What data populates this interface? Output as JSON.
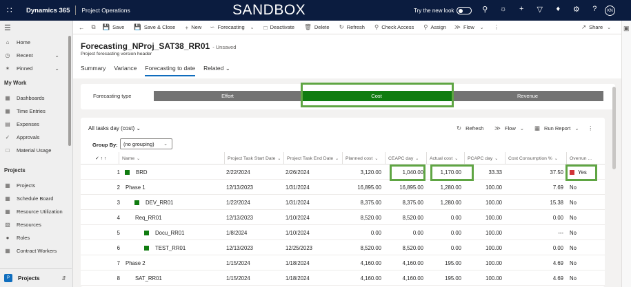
{
  "topbar": {
    "app_name": "Dynamics 365",
    "module_name": "Project Operations",
    "environment_label": "SANDBOX",
    "try_new_look": "Try the new look",
    "avatar_initials": "KN"
  },
  "sidebar": {
    "items": [
      {
        "label": "Home",
        "icon": "home-icon"
      },
      {
        "label": "Recent",
        "icon": "clock-icon"
      },
      {
        "label": "Pinned",
        "icon": "pin-icon"
      }
    ],
    "my_work_heading": "My Work",
    "my_work_items": [
      {
        "label": "Dashboards"
      },
      {
        "label": "Time Entries"
      },
      {
        "label": "Expenses"
      },
      {
        "label": "Approvals"
      },
      {
        "label": "Material Usage"
      }
    ],
    "projects_heading": "Projects",
    "project_items": [
      {
        "label": "Projects"
      },
      {
        "label": "Schedule Board"
      },
      {
        "label": "Resource Utilization"
      },
      {
        "label": "Resources"
      },
      {
        "label": "Roles"
      },
      {
        "label": "Contract Workers"
      }
    ],
    "area": {
      "badge": "P",
      "label": "Projects"
    }
  },
  "commandbar": {
    "save": "Save",
    "save_close": "Save & Close",
    "new": "New",
    "forecasting": "Forecasting",
    "deactivate": "Deactivate",
    "delete": "Delete",
    "refresh": "Refresh",
    "check_access": "Check Access",
    "assign": "Assign",
    "flow": "Flow",
    "share": "Share"
  },
  "record": {
    "title": "Forecasting_NProj_SAT38_RR01",
    "status": "- Unsaved",
    "subtitle": "Project forecasting version header",
    "tabs": [
      "Summary",
      "Variance",
      "Forecasting to date",
      "Related"
    ]
  },
  "forecast_type": {
    "label": "Forecasting type",
    "options": [
      "Effort",
      "Cost",
      "Revenue"
    ],
    "selected": "Cost"
  },
  "grid": {
    "view_name": "All tasks day (cost)",
    "refresh": "Refresh",
    "flow": "Flow",
    "run_report": "Run Report",
    "group_by_label": "Group By:",
    "group_by_value": "(no grouping)",
    "columns": [
      "Name",
      "Project Task Start Date",
      "Project Task End Date",
      "Planned cost",
      "CEAPC day",
      "Actual cost",
      "PCAPC day",
      "Cost Consumption %",
      "Overrun ..."
    ],
    "sort_label": "↑",
    "rows": [
      {
        "num": "1",
        "name": "BRD",
        "start": "2/22/2024",
        "end": "2/26/2024",
        "planned": "3,120.00",
        "ceapc": "1,040.00",
        "actual": "1,170.00",
        "pcapc": "33.33",
        "consumption": "37.50",
        "overrun": "Yes",
        "flag": true,
        "indent": 0,
        "overrun_flag": true
      },
      {
        "num": "2",
        "name": "Phase 1",
        "start": "12/13/2023",
        "end": "1/31/2024",
        "planned": "16,895.00",
        "ceapc": "16,895.00",
        "actual": "1,280.00",
        "pcapc": "100.00",
        "consumption": "7.69",
        "overrun": "No",
        "flag": false,
        "indent": 0,
        "overrun_flag": false
      },
      {
        "num": "3",
        "name": "DEV_RR01",
        "start": "1/22/2024",
        "end": "1/31/2024",
        "planned": "8,375.00",
        "ceapc": "8,375.00",
        "actual": "1,280.00",
        "pcapc": "100.00",
        "consumption": "15.38",
        "overrun": "No",
        "flag": true,
        "indent": 1,
        "overrun_flag": false
      },
      {
        "num": "4",
        "name": "Req_RR01",
        "start": "12/13/2023",
        "end": "1/10/2024",
        "planned": "8,520.00",
        "ceapc": "8,520.00",
        "actual": "0.00",
        "pcapc": "100.00",
        "consumption": "0.00",
        "overrun": "No",
        "flag": false,
        "indent": 1,
        "overrun_flag": false
      },
      {
        "num": "5",
        "name": "Docu_RR01",
        "start": "1/8/2024",
        "end": "1/10/2024",
        "planned": "0.00",
        "ceapc": "0.00",
        "actual": "0.00",
        "pcapc": "100.00",
        "consumption": "---",
        "overrun": "No",
        "flag": true,
        "indent": 2,
        "overrun_flag": false
      },
      {
        "num": "6",
        "name": "TEST_RR01",
        "start": "12/13/2023",
        "end": "12/25/2023",
        "planned": "8,520.00",
        "ceapc": "8,520.00",
        "actual": "0.00",
        "pcapc": "100.00",
        "consumption": "0.00",
        "overrun": "No",
        "flag": true,
        "indent": 2,
        "overrun_flag": false
      },
      {
        "num": "7",
        "name": "Phase 2",
        "start": "1/15/2024",
        "end": "1/18/2024",
        "planned": "4,160.00",
        "ceapc": "4,160.00",
        "actual": "195.00",
        "pcapc": "100.00",
        "consumption": "4.69",
        "overrun": "No",
        "flag": false,
        "indent": 0,
        "overrun_flag": false
      },
      {
        "num": "8",
        "name": "SAT_RR01",
        "start": "1/15/2024",
        "end": "1/18/2024",
        "planned": "4,160.00",
        "ceapc": "4,160.00",
        "actual": "195.00",
        "pcapc": "100.00",
        "consumption": "4.69",
        "overrun": "No",
        "flag": false,
        "indent": 1,
        "overrun_flag": false
      }
    ]
  },
  "colors": {
    "topbar": "#0b1c3f",
    "selected_segment": "#107c10",
    "unselected_segment": "#737373",
    "highlight_box": "#5fa543",
    "task_flag": "#107c10",
    "overrun_flag": "#d13438",
    "tab_underline": "#0f6cbd"
  }
}
